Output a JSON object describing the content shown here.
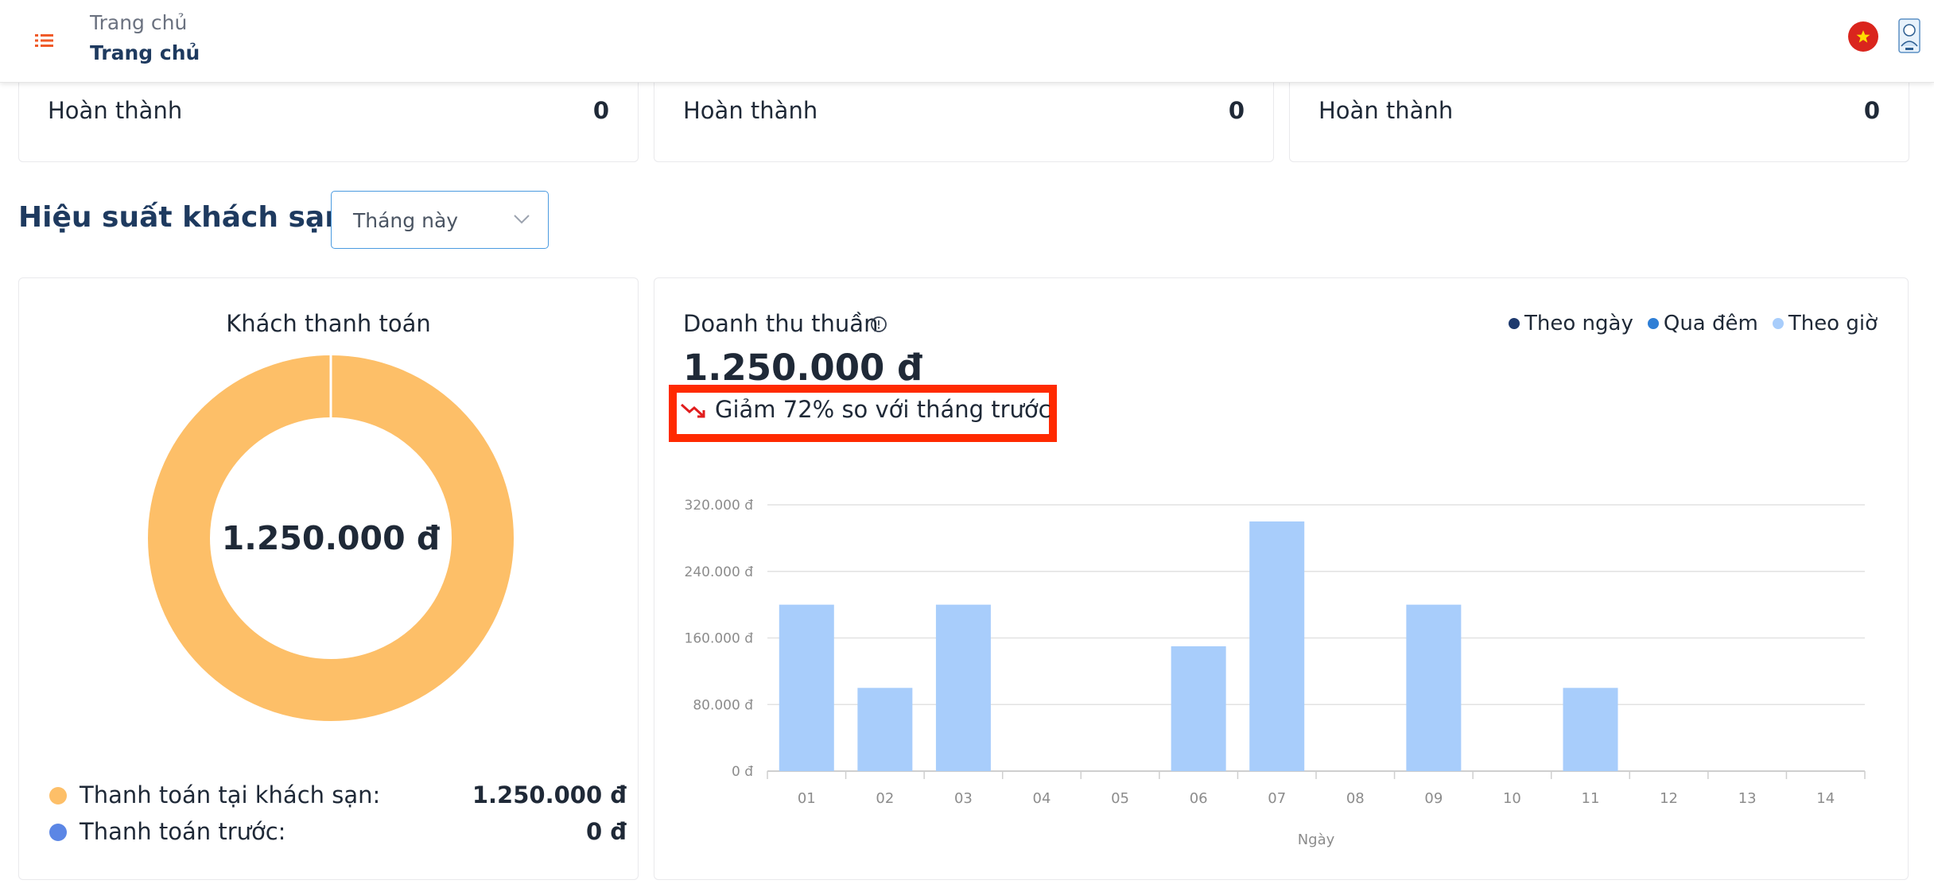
{
  "header": {
    "breadcrumb_parent": "Trang chủ",
    "page_title": "Trang chủ"
  },
  "summary_cards": [
    {
      "label": "Hoàn thành",
      "value": "0"
    },
    {
      "label": "Hoàn thành",
      "value": "0"
    },
    {
      "label": "Hoàn thành",
      "value": "0"
    }
  ],
  "section": {
    "title": "Hiệu suất khách sạn",
    "period_select": {
      "value": "Tháng này"
    }
  },
  "payment_card": {
    "title": "Khách thanh toán",
    "center_total": "1.250.000 đ",
    "legend": [
      {
        "label": "Thanh toán tại khách sạn:",
        "value": "1.250.000 đ",
        "color": "#fdbf68",
        "share": 1.0
      },
      {
        "label": "Thanh toán trước:",
        "value": "0 đ",
        "color": "#5b86e5",
        "share": 0.0
      }
    ]
  },
  "revenue_card": {
    "title": "Doanh thu thuần",
    "total": "1.250.000 đ",
    "trend_text": "Giảm 72% so với tháng trước",
    "series_legend": [
      {
        "label": "Theo ngày",
        "color": "#1e3a6e"
      },
      {
        "label": "Qua đêm",
        "color": "#2f7fd6"
      },
      {
        "label": "Theo giờ",
        "color": "#a8cdfb"
      }
    ]
  },
  "chart_data": {
    "type": "bar",
    "categories": [
      "01",
      "02",
      "03",
      "04",
      "05",
      "06",
      "07",
      "08",
      "09",
      "10",
      "11",
      "12",
      "13",
      "14"
    ],
    "values": [
      200000,
      100000,
      200000,
      0,
      0,
      150000,
      300000,
      0,
      200000,
      0,
      100000,
      0,
      0,
      0
    ],
    "y_ticks": [
      "0 đ",
      "80.000 đ",
      "160.000 đ",
      "240.000 đ",
      "320.000 đ"
    ],
    "ylim": [
      0,
      320000
    ],
    "xlabel": "Ngày",
    "ylabel": "",
    "grid": true,
    "bar_color": "#a8cdfb"
  },
  "colors": {
    "accent": "#f05a28",
    "title_navy": "#1e3a5f",
    "trend_down": "#e11d1d",
    "highlight_box": "#ff2a00"
  }
}
